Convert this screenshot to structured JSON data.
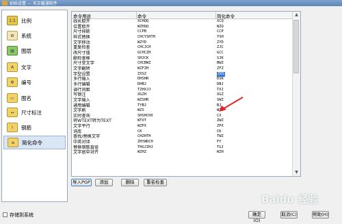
{
  "window": {
    "title": "初始设置 — 天正暖通软件"
  },
  "sidebar": {
    "items": [
      {
        "label": "比例",
        "icon": "scale-icon"
      },
      {
        "label": "系统",
        "icon": "system-icon"
      },
      {
        "label": "图层",
        "icon": "layers-icon"
      },
      {
        "label": "文字",
        "icon": "text-icon"
      },
      {
        "label": "编号",
        "icon": "numbering-icon"
      },
      {
        "label": "图名",
        "icon": "drawing-name-icon"
      },
      {
        "label": "尺寸标注",
        "icon": "dimension-icon"
      },
      {
        "label": "钢筋",
        "icon": "rebar-icon"
      },
      {
        "label": "简化命令",
        "icon": "shortcut-command-icon"
      }
    ]
  },
  "table": {
    "headers": [
      "命令用途",
      "命令",
      "简化命令"
    ],
    "rows": [
      [
        "线长取齐",
        "XCHQQ",
        "XCQ"
      ],
      [
        "位置取齐",
        "WZHQQ",
        "WZQ"
      ],
      [
        "尺寸排斯",
        "CCPB",
        "CCP"
      ],
      [
        "样式替换",
        "CHCYSHTH",
        "YSH"
      ],
      [
        "文字移动",
        "WZYD",
        "ZYD"
      ],
      [
        "重复检查",
        "CHCJCH",
        "ZJC"
      ],
      [
        "改尺寸值",
        "GCHCZH",
        "GCC"
      ],
      [
        "删检查框",
        "SHJCK",
        "SJK"
      ],
      [
        "尺寸变文字",
        "CHCBWZ",
        "BWZ"
      ],
      [
        "文字翻转",
        "WZFZH",
        "ZFZ"
      ],
      [
        "字型设置",
        "ZXSZ",
        "ZXS"
      ],
      [
        "多行输入",
        "DHSHR",
        "DSR"
      ],
      [
        "多行编辑",
        "DHBJ",
        "DBJ"
      ],
      [
        "调行间距",
        "TZHXJJ",
        "TXJ"
      ],
      [
        "写钢注",
        "XGZH",
        "XGZ"
      ],
      [
        "文字输入",
        "WZSHR",
        "SWZ"
      ],
      [
        "通用编辑",
        "TYBJ",
        "BJ"
      ],
      [
        "文字刷",
        "WZS",
        "WZS"
      ],
      [
        "实时查询",
        "SHSHCHX",
        "CX"
      ],
      [
        "将WTEXT转为TEXT",
        "WTOT",
        "ZWZ"
      ],
      [
        "文字平行",
        "WZPX",
        "ZPX"
      ],
      [
        "词库",
        "CK",
        "CK"
      ],
      [
        "查找/替换文字",
        "CHZHTH",
        "TWZ"
      ],
      [
        "中英对译",
        "ZHYWDCH",
        "FY"
      ],
      [
        "替换钢筋直径",
        "THGJZHJ",
        "TGJ"
      ],
      [
        "文字居中对齐",
        "WZHZ",
        "WZH"
      ]
    ],
    "highlighted_row": 10
  },
  "buttons": {
    "import": "导入PGP",
    "add": "添加",
    "delete": "删除",
    "check": "重名检查"
  },
  "footer": {
    "save_to_system": "存储到系统",
    "ok": "确定(O)",
    "cancel": "取消(C)",
    "help": "帮助(H)"
  },
  "watermark": "Baidu 经验",
  "colors": {
    "accent": "#3a78d6",
    "annotation": "#e0262a"
  }
}
